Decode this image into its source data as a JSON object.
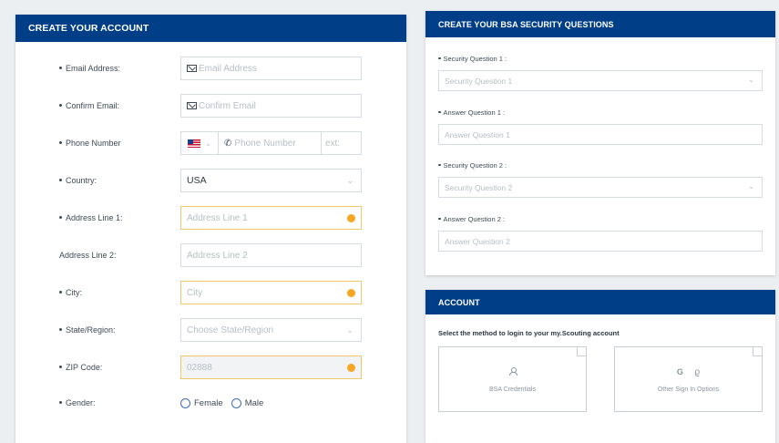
{
  "account_form": {
    "title": "CREATE YOUR ACCOUNT",
    "email": {
      "label": "Email Address:",
      "placeholder": "Email Address",
      "icon": "mail-icon"
    },
    "confirm_email": {
      "label": "Confirm Email:",
      "placeholder": "Confirm Email",
      "icon": "mail-icon"
    },
    "phone": {
      "label": "Phone Number",
      "country_flag": "us-flag-icon",
      "placeholder": "Phone Number",
      "icon": "phone-icon",
      "ext_placeholder": "ext:"
    },
    "country": {
      "label": "Country:",
      "value": "USA"
    },
    "address1": {
      "label": "Address Line 1:",
      "placeholder": "Address Line 1"
    },
    "address2": {
      "label": "Address Line 2:",
      "placeholder": "Address Line 2"
    },
    "city": {
      "label": "City:",
      "placeholder": "City"
    },
    "state": {
      "label": "State/Region:",
      "placeholder": "Choose State/Region"
    },
    "zip": {
      "label": "ZIP Code:",
      "value": "02888"
    },
    "gender": {
      "label": "Gender:",
      "options": [
        "Female",
        "Male"
      ]
    }
  },
  "security_questions": {
    "title": "CREATE YOUR BSA SECURITY QUESTIONS",
    "q1": {
      "label": "Security Question 1 :",
      "placeholder": "Security Question 1"
    },
    "a1": {
      "label": "Answer Question 1 :",
      "placeholder": "Answer Question 1"
    },
    "q2": {
      "label": "Security Question 2 :",
      "placeholder": "Security Question 2"
    },
    "a2": {
      "label": "Answer Question 2 :",
      "placeholder": "Answer Question 2"
    }
  },
  "login": {
    "title": "ACCOUNT",
    "prompt": "Select the method to login to your my.Scouting account",
    "options": [
      {
        "label": "BSA Credentials",
        "icons": [
          "user-icon"
        ]
      },
      {
        "label": "Other Sign In Options",
        "icons": [
          "google-icon",
          "apple-icon"
        ],
        "icon_glyphs": [
          "G",
          ""
        ]
      }
    ]
  },
  "colors": {
    "header_blue": "#003f87",
    "warning_orange": "#f6a623",
    "warning_border": "#f2c76a"
  }
}
